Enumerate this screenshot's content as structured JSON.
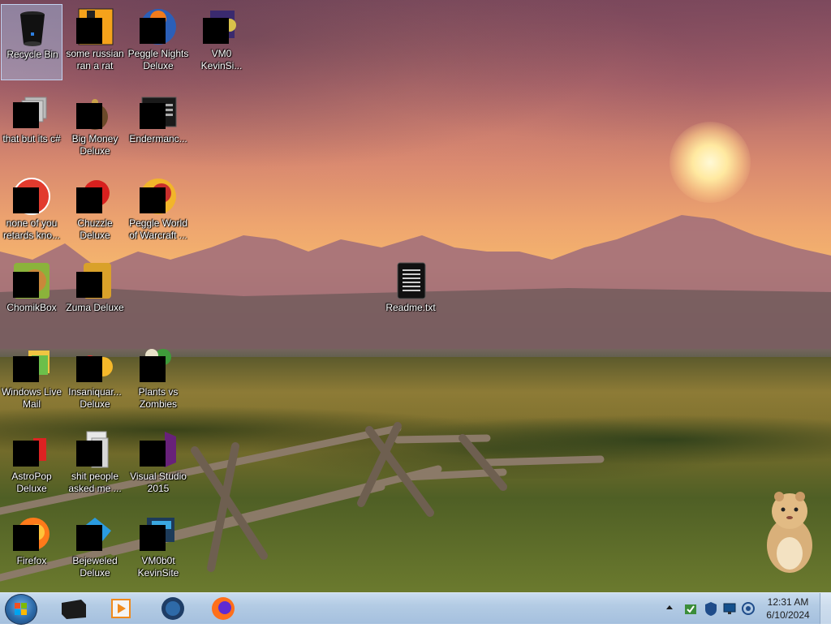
{
  "desktop": {
    "icons": [
      {
        "label": "Recycle Bin",
        "icon": "recycle-bin-icon"
      },
      {
        "label": "some russian ran a rat",
        "icon": "java-file-icon"
      },
      {
        "label": "Peggle Nights Deluxe",
        "icon": "peggle-nights-icon"
      },
      {
        "label": "VM0 KevinSi...",
        "icon": "vm-shortcut-icon"
      },
      {
        "label": "that but its c#",
        "icon": "folder-icon"
      },
      {
        "label": "Big Money Deluxe",
        "icon": "big-money-icon"
      },
      {
        "label": "Endermanc...",
        "icon": "terminal-icon"
      },
      {
        "label": "none of you retards kno...",
        "icon": "game-icon"
      },
      {
        "label": "Chuzzle Deluxe",
        "icon": "chuzzle-icon"
      },
      {
        "label": "Peggle World of Warcraft ...",
        "icon": "peggle-wow-icon"
      },
      {
        "label": "ChomikBox",
        "icon": "chomikbox-icon"
      },
      {
        "label": "Zuma Deluxe",
        "icon": "zuma-icon"
      },
      {
        "label": "Readme.txt",
        "icon": "text-file-icon"
      },
      {
        "label": "Windows Live Mail",
        "icon": "windows-live-mail-icon"
      },
      {
        "label": "Insaniquar... Deluxe",
        "icon": "insaniquarium-icon"
      },
      {
        "label": "Plants vs Zombies",
        "icon": "plants-vs-zombies-icon"
      },
      {
        "label": "AstroPop Deluxe",
        "icon": "astropop-icon"
      },
      {
        "label": "shit people asked me ...",
        "icon": "document-icon"
      },
      {
        "label": "Visual Studio 2015",
        "icon": "visual-studio-icon"
      },
      {
        "label": "Firefox",
        "icon": "firefox-icon"
      },
      {
        "label": "Bejeweled Deluxe",
        "icon": "bejeweled-icon"
      },
      {
        "label": "VM0b0t KevinSite",
        "icon": "vm-shortcut-icon"
      }
    ]
  },
  "taskbar": {
    "start_button": "windows-start-icon",
    "pinned": [
      "terminal-icon",
      "media-player-icon",
      "network-globe-icon",
      "firefox-icon"
    ],
    "tray_icons": [
      "show-hidden-icons-chevron",
      "security-center-icon",
      "shield-icon",
      "monitor-icon",
      "network-icon"
    ],
    "clock": {
      "time": "12:31 AM",
      "date": "6/10/2024"
    }
  },
  "colors": {
    "taskbar": "#b3cbe4",
    "selection": "#aac8f0"
  }
}
